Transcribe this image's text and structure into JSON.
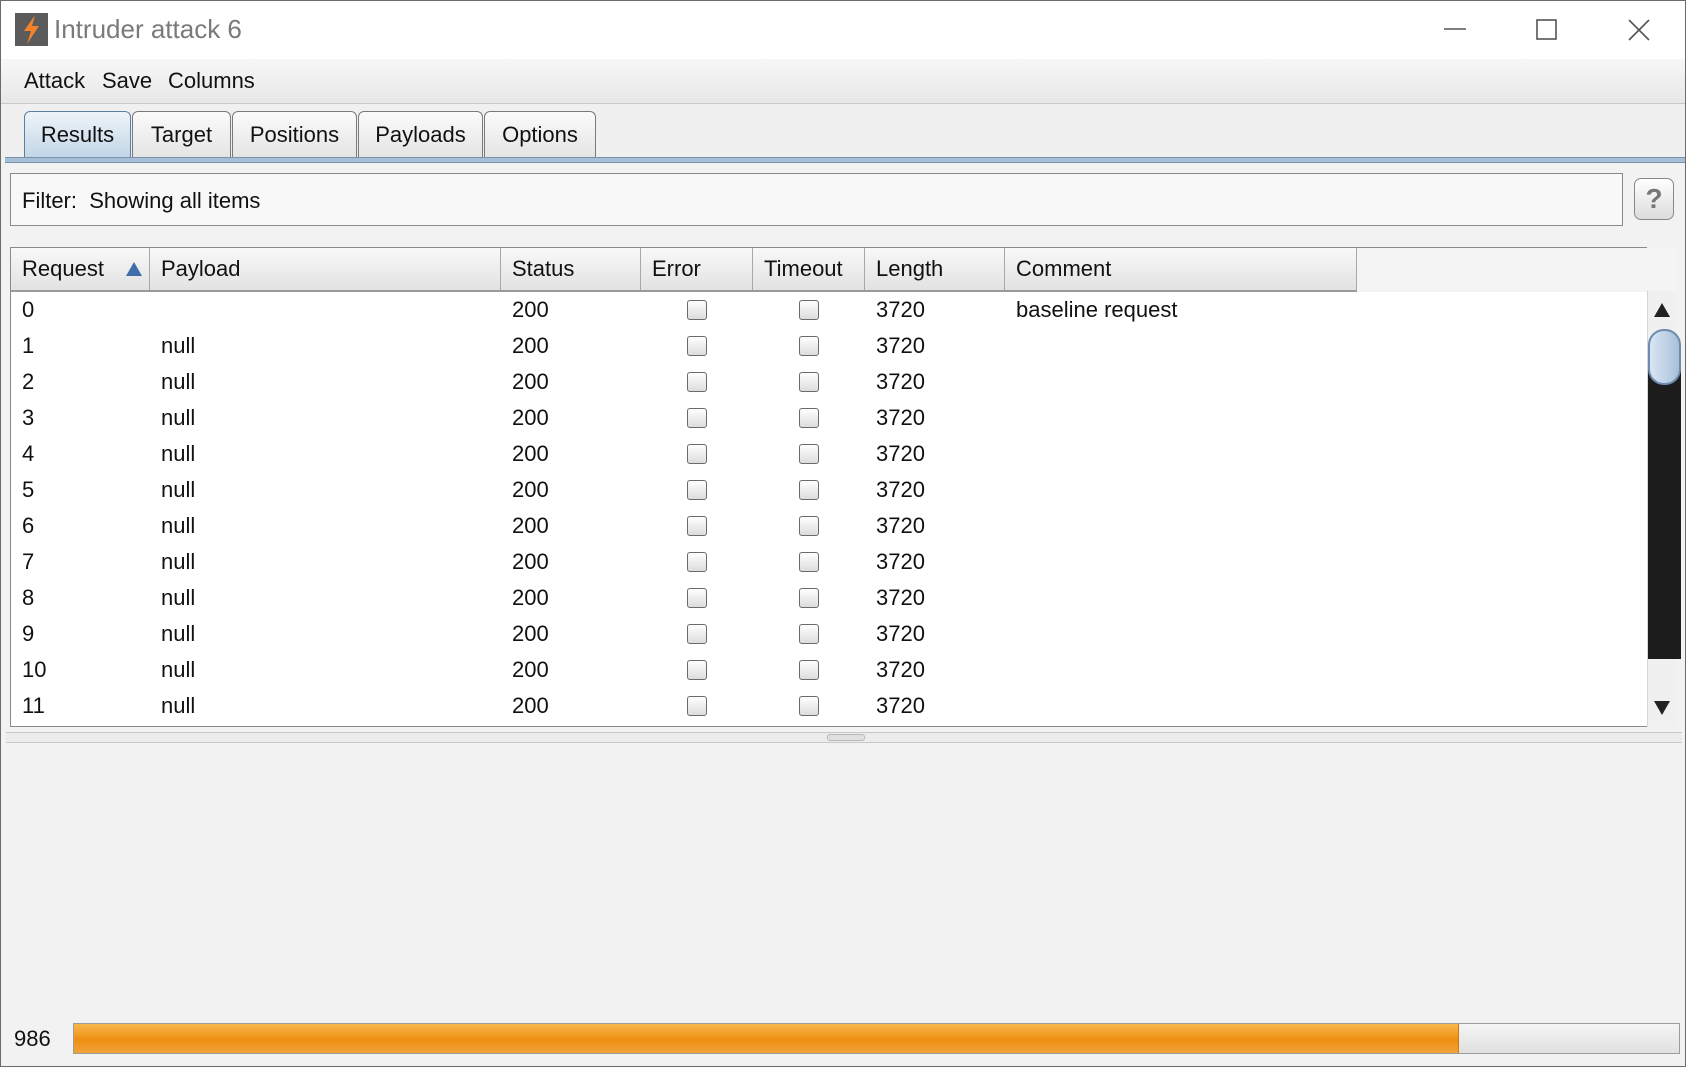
{
  "window": {
    "title": "Intruder attack 6",
    "icon": "burp-lightning-icon",
    "controls": [
      "minimize-icon",
      "maximize-icon",
      "close-icon"
    ]
  },
  "menu": [
    "Attack",
    "Save",
    "Columns"
  ],
  "tabs": [
    {
      "label": "Results",
      "active": true
    },
    {
      "label": "Target",
      "active": false
    },
    {
      "label": "Positions",
      "active": false
    },
    {
      "label": "Payloads",
      "active": false
    },
    {
      "label": "Options",
      "active": false
    }
  ],
  "filter": {
    "label": "Filter:",
    "value": "Showing all items",
    "help_label": "?"
  },
  "table": {
    "columns": [
      "Request",
      "Payload",
      "Status",
      "Error",
      "Timeout",
      "Length",
      "Comment"
    ],
    "sorted_column": "Request",
    "sort_direction": "ascending",
    "rows": [
      {
        "request": "0",
        "payload": "",
        "status": "200",
        "error": false,
        "timeout": false,
        "length": "3720",
        "comment": "baseline request"
      },
      {
        "request": "1",
        "payload": "null",
        "status": "200",
        "error": false,
        "timeout": false,
        "length": "3720",
        "comment": ""
      },
      {
        "request": "2",
        "payload": "null",
        "status": "200",
        "error": false,
        "timeout": false,
        "length": "3720",
        "comment": ""
      },
      {
        "request": "3",
        "payload": "null",
        "status": "200",
        "error": false,
        "timeout": false,
        "length": "3720",
        "comment": ""
      },
      {
        "request": "4",
        "payload": "null",
        "status": "200",
        "error": false,
        "timeout": false,
        "length": "3720",
        "comment": ""
      },
      {
        "request": "5",
        "payload": "null",
        "status": "200",
        "error": false,
        "timeout": false,
        "length": "3720",
        "comment": ""
      },
      {
        "request": "6",
        "payload": "null",
        "status": "200",
        "error": false,
        "timeout": false,
        "length": "3720",
        "comment": ""
      },
      {
        "request": "7",
        "payload": "null",
        "status": "200",
        "error": false,
        "timeout": false,
        "length": "3720",
        "comment": ""
      },
      {
        "request": "8",
        "payload": "null",
        "status": "200",
        "error": false,
        "timeout": false,
        "length": "3720",
        "comment": ""
      },
      {
        "request": "9",
        "payload": "null",
        "status": "200",
        "error": false,
        "timeout": false,
        "length": "3720",
        "comment": ""
      },
      {
        "request": "10",
        "payload": "null",
        "status": "200",
        "error": false,
        "timeout": false,
        "length": "3720",
        "comment": ""
      },
      {
        "request": "11",
        "payload": "null",
        "status": "200",
        "error": false,
        "timeout": false,
        "length": "3720",
        "comment": ""
      }
    ]
  },
  "status": {
    "request_count": "986",
    "progress_fraction": 0.862
  },
  "colors": {
    "progress": "#ee8f12",
    "active_tab": "#bfd3e5",
    "sort_arrow": "#3f6ea8"
  }
}
